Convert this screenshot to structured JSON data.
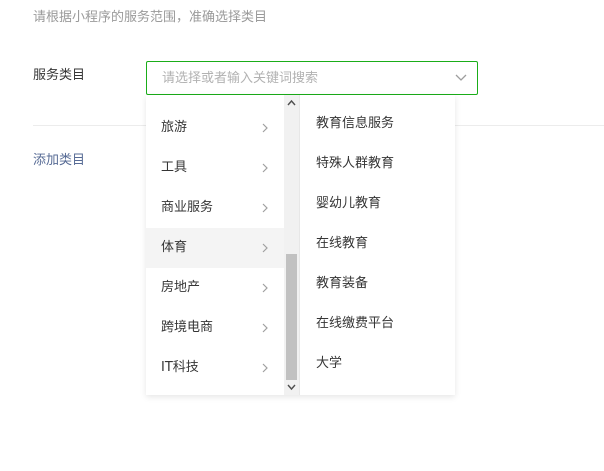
{
  "hint_text": "请根据小程序的服务范围，准确选择类目",
  "field_label": "服务类目",
  "select": {
    "placeholder": "请选择或者输入关键词搜索",
    "value": ""
  },
  "add_link": "添加类目",
  "dropdown": {
    "left_items": [
      {
        "label": "旅游",
        "active": false
      },
      {
        "label": "工具",
        "active": false
      },
      {
        "label": "商业服务",
        "active": false
      },
      {
        "label": "体育",
        "active": true
      },
      {
        "label": "房地产",
        "active": false
      },
      {
        "label": "跨境电商",
        "active": false
      },
      {
        "label": "IT科技",
        "active": false
      }
    ],
    "right_items": [
      {
        "label": "教育信息服务"
      },
      {
        "label": "特殊人群教育"
      },
      {
        "label": "婴幼儿教育"
      },
      {
        "label": "在线教育"
      },
      {
        "label": "教育装备"
      },
      {
        "label": "在线缴费平台"
      },
      {
        "label": "大学"
      }
    ]
  },
  "colors": {
    "accent_border": "#1aad19",
    "link": "#576b95",
    "active_row": "#f4f4f4"
  },
  "icons": {
    "select_arrow": "chevron-down-icon",
    "item_arrow": "chevron-right-icon",
    "scroll_up": "arrow-up-icon",
    "scroll_down": "arrow-down-icon"
  }
}
